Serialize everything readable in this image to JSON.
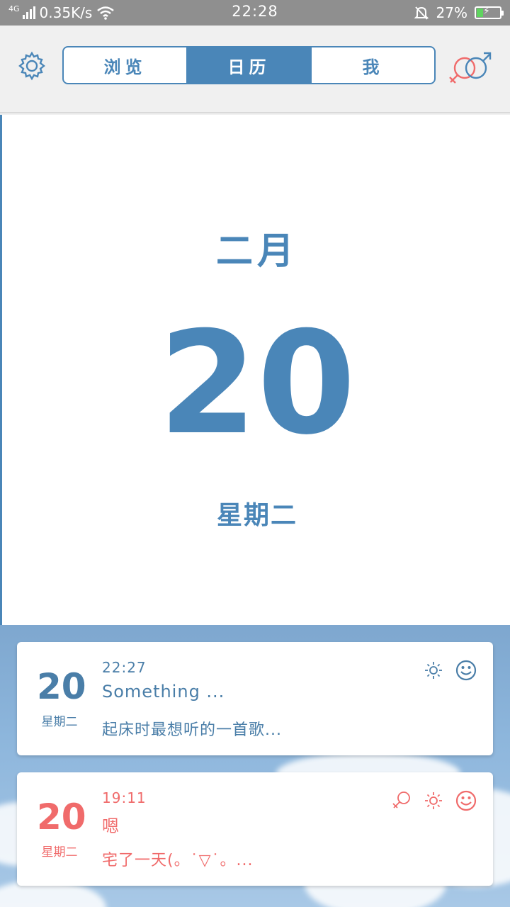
{
  "status_bar": {
    "network_type": "4G",
    "speed": "0.35K/s",
    "time": "22:28",
    "battery": "27%",
    "battery_level": 0.27
  },
  "top_bar": {
    "tabs": [
      {
        "label": "浏览",
        "active": false
      },
      {
        "label": "日历",
        "active": true
      },
      {
        "label": "我",
        "active": false
      }
    ]
  },
  "calendar": {
    "month": "二月",
    "day": "20",
    "weekday": "星期二"
  },
  "entries": [
    {
      "day": "20",
      "weekday": "星期二",
      "time": "22:27",
      "title": "Something ...",
      "excerpt": "起床时最想听的一首歌...",
      "color": "#4a7ea8",
      "icons": [
        "sun-icon",
        "smiley-icon"
      ]
    },
    {
      "day": "20",
      "weekday": "星期二",
      "time": "19:11",
      "title": "嗯",
      "excerpt": "宅了一天(。˙▽˙。...",
      "color": "#f06b6b",
      "icons": [
        "female-icon",
        "sun-icon",
        "smiley-icon"
      ]
    }
  ],
  "colors": {
    "accent": "#4a86b8",
    "entry_blue": "#4a7ea8",
    "entry_red": "#f06b6b",
    "status_bar": "#8f8f8f"
  }
}
